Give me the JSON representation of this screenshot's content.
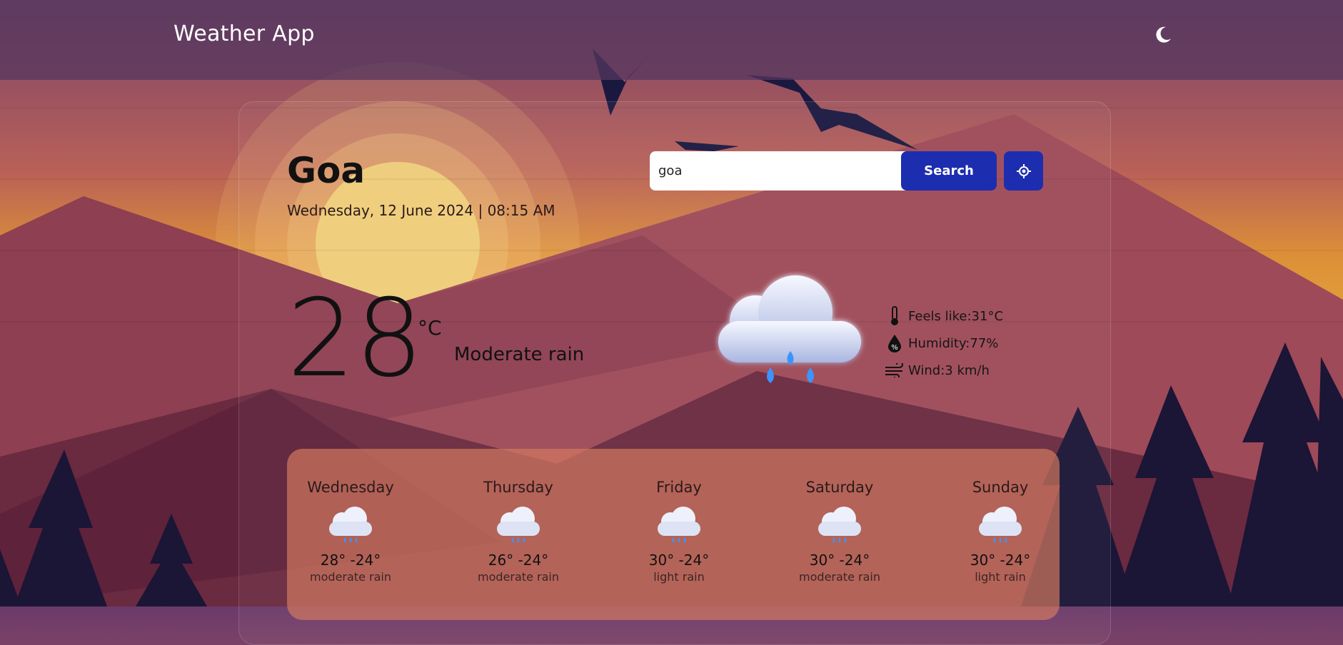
{
  "app": {
    "title": "Weather App"
  },
  "theme_toggle": {
    "icon": "moon-icon"
  },
  "location": {
    "city": "Goa",
    "datetime": "Wednesday, 12 June 2024 | 08:15 AM"
  },
  "search": {
    "value": "goa",
    "button_label": "Search",
    "locate_icon": "crosshair-icon"
  },
  "current": {
    "temperature": "28",
    "unit": "°C",
    "condition": "Moderate rain",
    "icon": "rain-cloud-icon",
    "details": [
      {
        "icon": "thermometer-icon",
        "text": "Feels like:31°C"
      },
      {
        "icon": "humidity-icon",
        "text": "Humidity:77%"
      },
      {
        "icon": "wind-icon",
        "text": "Wind:3 km/h"
      }
    ]
  },
  "forecast": [
    {
      "day": "Wednesday",
      "range": "28° -24°",
      "desc": "moderate rain",
      "icon": "rain-cloud-icon"
    },
    {
      "day": "Thursday",
      "range": "26° -24°",
      "desc": "moderate rain",
      "icon": "rain-cloud-icon"
    },
    {
      "day": "Friday",
      "range": "30° -24°",
      "desc": "light rain",
      "icon": "rain-cloud-icon"
    },
    {
      "day": "Saturday",
      "range": "30° -24°",
      "desc": "moderate rain",
      "icon": "rain-cloud-icon"
    },
    {
      "day": "Sunday",
      "range": "30° -24°",
      "desc": "light rain",
      "icon": "rain-cloud-icon"
    }
  ],
  "colors": {
    "accent": "#1c2db0",
    "navbar": "#55375f",
    "text_dark": "#111111"
  }
}
